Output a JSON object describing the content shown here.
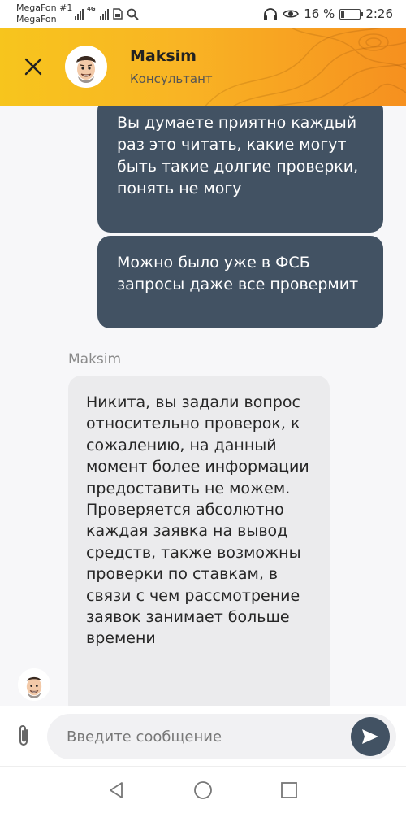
{
  "status_bar": {
    "carrier_primary": "MegaFon #1",
    "carrier_secondary": "MegaFon",
    "network_type": "4G",
    "battery_percent": "16 %",
    "battery_level": 0.16,
    "time": "2:26",
    "icons": [
      "signal-icon",
      "signal-4g-icon",
      "sim-card-icon",
      "search-icon",
      "headphones-icon",
      "eye-icon",
      "battery-icon"
    ]
  },
  "header": {
    "agent_name": "Maksim",
    "agent_role": "Консультант",
    "close_icon": "close-icon",
    "colors": {
      "gradient_start": "#f7c51d",
      "gradient_end": "#f6901f"
    }
  },
  "messages": [
    {
      "direction": "outgoing",
      "text": "Вы думаете приятно каждый раз это читать, какие могут быть такие долгие проверки, понять не могу"
    },
    {
      "direction": "outgoing",
      "text": "Можно было уже в ФСБ запросы даже все провермит"
    },
    {
      "direction": "incoming",
      "sender": "Maksim",
      "text": "Никита, вы задали вопрос относительно проверок, к сожалению, на данный момент более информации предоставить не можем. Проверяется абсолютно каждая заявка на вывод средств, также возможны проверки по ставкам, в связи с чем рассмотрение заявок занимает больше времени"
    }
  ],
  "composer": {
    "placeholder": "Введите сообщение",
    "value": "",
    "attach_icon": "paperclip-icon",
    "send_icon": "send-icon"
  },
  "nav_bar": {
    "icons": [
      "back-icon",
      "home-icon",
      "recents-icon"
    ]
  },
  "colors": {
    "outgoing_bubble": "#425263",
    "incoming_bubble": "#ebebed",
    "chat_background": "#f7f7f9"
  }
}
